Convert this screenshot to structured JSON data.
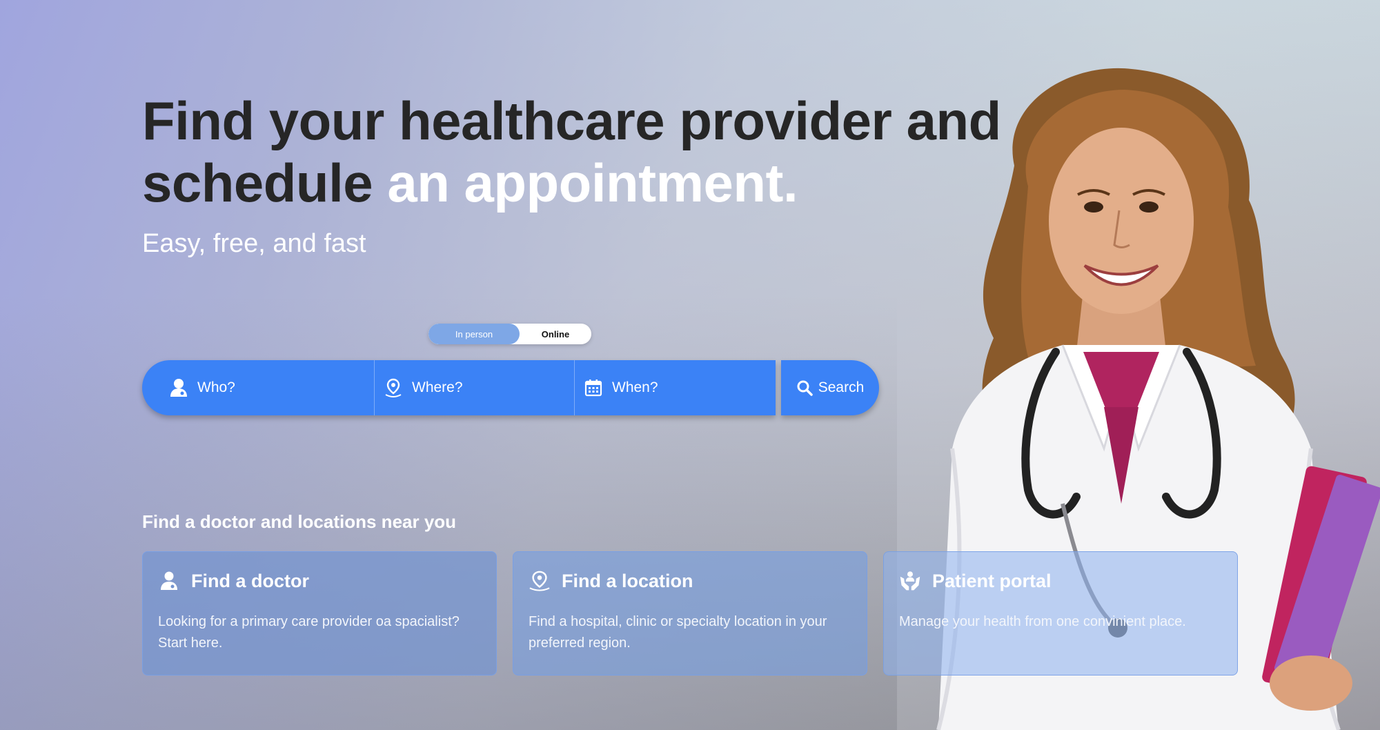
{
  "hero": {
    "headline_dark": "Find your healthcare provider and schedule",
    "headline_light": "an appointment.",
    "subtitle": "Easy, free, and fast"
  },
  "toggle": {
    "options": [
      "In person",
      "Online"
    ],
    "selected": "In person"
  },
  "search": {
    "who_placeholder": "Who?",
    "where_placeholder": "Where?",
    "when_placeholder": "When?",
    "button_label": "Search"
  },
  "section": {
    "title": "Find a doctor and locations near you"
  },
  "cards": [
    {
      "icon": "doctor-icon",
      "title": "Find a doctor",
      "description": "Looking for a primary care provider oa spacialist? Start here."
    },
    {
      "icon": "location-pin-icon",
      "title": "Find a location",
      "description": "Find a hospital, clinic or specialty location in your preferred region."
    },
    {
      "icon": "care-hands-icon",
      "title": "Patient portal",
      "description": "Manage your health from one convinient place."
    }
  ],
  "colors": {
    "accent": "#3b82f6",
    "toggle_active": "#7ea7e6",
    "headline": "#262626"
  }
}
